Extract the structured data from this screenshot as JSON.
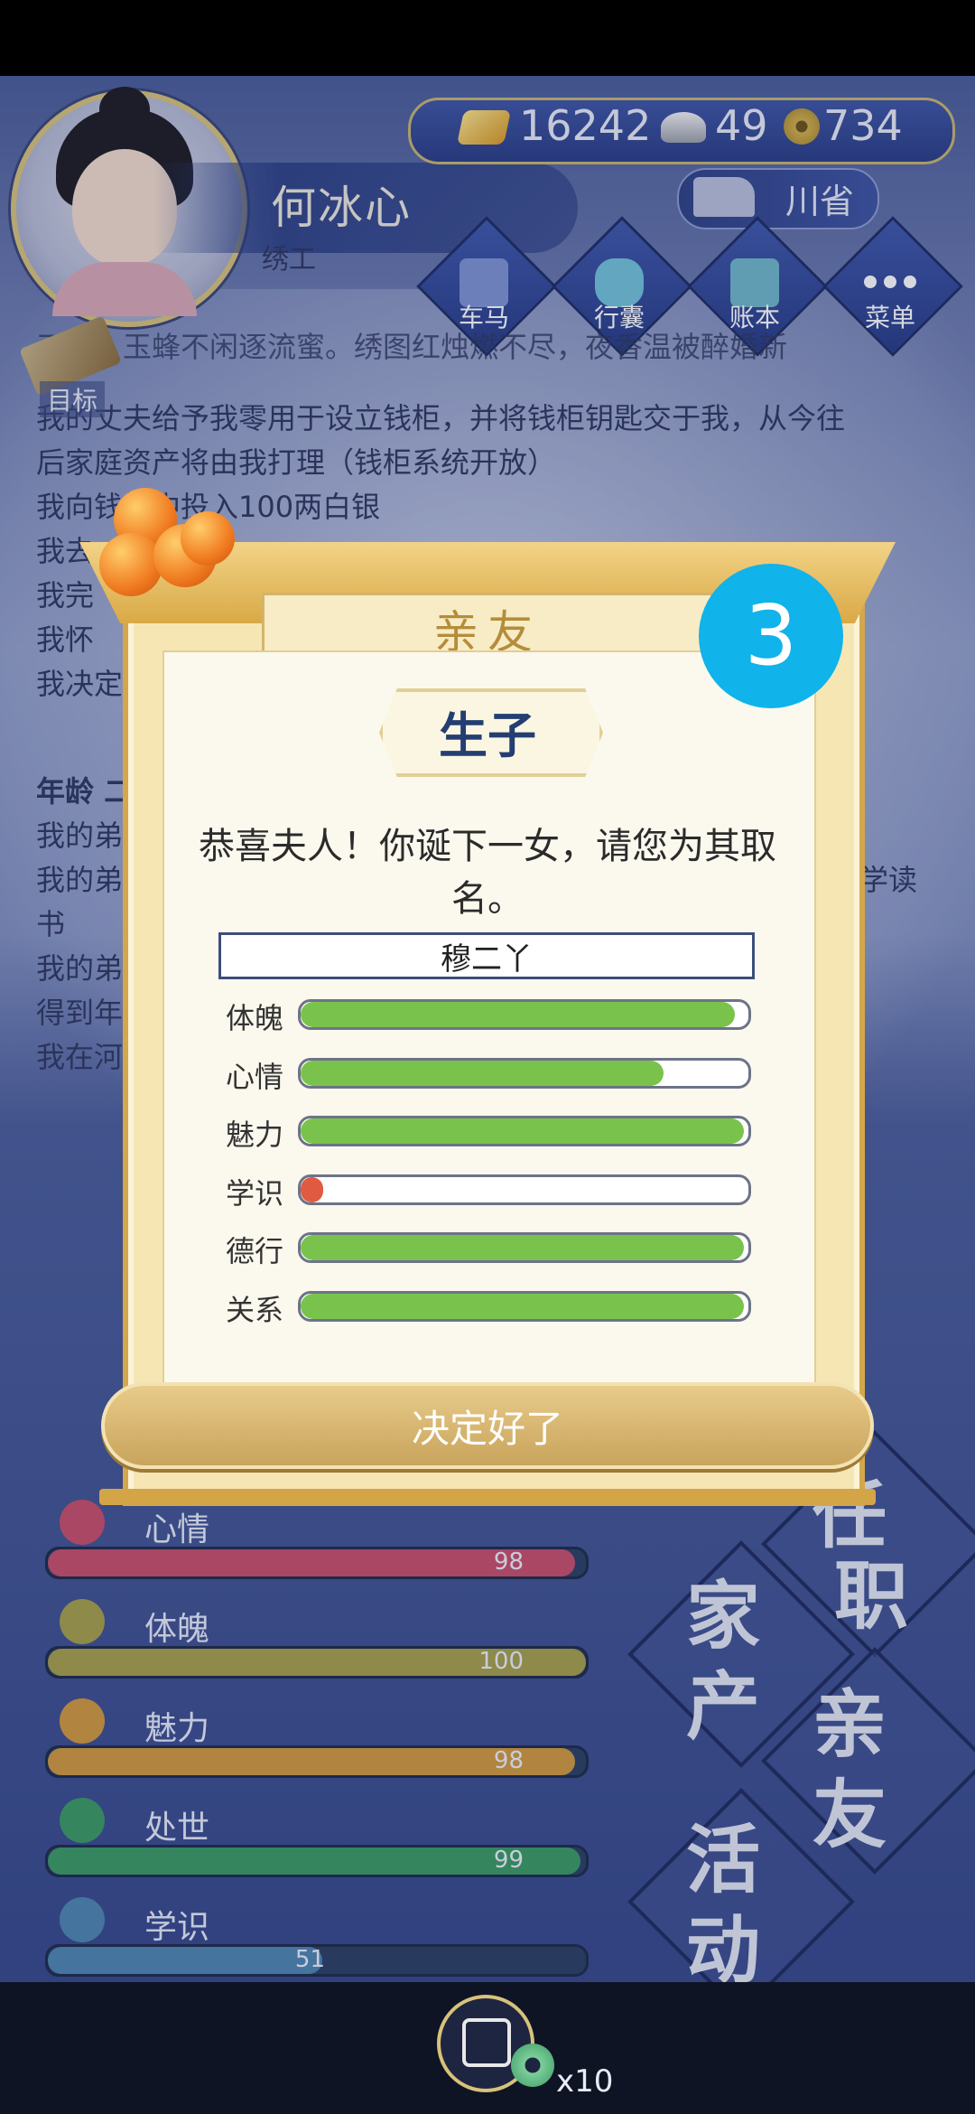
{
  "player": {
    "name": "何冰心",
    "title": "绣工",
    "region": "川省"
  },
  "currency": {
    "gold": "16242",
    "silver": "49",
    "coin": "734"
  },
  "nav": [
    {
      "label": "车马",
      "icon": "carriage-icon"
    },
    {
      "label": "行囊",
      "icon": "bag-icon"
    },
    {
      "label": "账本",
      "icon": "ledger-icon"
    },
    {
      "label": "菜单",
      "icon": "menu-icon"
    }
  ],
  "goal_label": "目标",
  "story": {
    "partial_top": "天喜，玉蜂不闲逐流蜜。绣图红烛燃不尽，夜香温被醉婚新",
    "lines": [
      "我的丈夫给予我零用于设立钱柜，并将钱柜钥匙交于我，从今往",
      "后家庭资产将由我打理（钱柜系统开放）",
      "我向钱柜中投入100两白银",
      "我去",
      "我完",
      "我怀",
      "我决定"
    ],
    "age_heading": "年龄 二",
    "lines2": [
      "我的弟",
      "我的弟",
      "书",
      "我的弟",
      "得到年",
      "我在河"
    ],
    "line2_tail": "学读"
  },
  "stats": [
    {
      "label": "心情",
      "value": 98,
      "max": 100,
      "color": "#c94f69",
      "icon": "flower-icon"
    },
    {
      "label": "体魄",
      "value": 100,
      "max": 100,
      "color": "#a7a04a",
      "icon": "dumbbell-icon"
    },
    {
      "label": "魅力",
      "value": 98,
      "max": 100,
      "color": "#d29a3d",
      "icon": "mirror-icon"
    },
    {
      "label": "处世",
      "value": 99,
      "max": 100,
      "color": "#3b9a63",
      "icon": "scroll-icon"
    },
    {
      "label": "学识",
      "value": 51,
      "max": 100,
      "color": "#4f86b0",
      "icon": "brush-pot-icon"
    },
    {
      "label": "德行",
      "value": "",
      "max": 100,
      "color": "#9a3f6c",
      "icon": "medal-icon"
    }
  ],
  "side_buttons": [
    "任职",
    "家产",
    "亲友",
    "活动"
  ],
  "side_button_top_partial": "任",
  "reward": {
    "count": "x10"
  },
  "modal": {
    "header": "亲友",
    "step": "3",
    "subtitle": "生子",
    "message": "恭喜夫人！你诞下一女，请您为其取名。",
    "name_value": "穆二丫",
    "attributes": [
      {
        "label": "体魄",
        "fraction": 0.97,
        "color": "#79c34c"
      },
      {
        "label": "心情",
        "fraction": 0.81,
        "color": "#79c34c"
      },
      {
        "label": "魅力",
        "fraction": 0.99,
        "color": "#79c34c"
      },
      {
        "label": "学识",
        "fraction": 0.05,
        "color": "#e05a42"
      },
      {
        "label": "德行",
        "fraction": 0.99,
        "color": "#79c34c"
      },
      {
        "label": "关系",
        "fraction": 0.99,
        "color": "#79c34c"
      }
    ],
    "confirm_label": "决定好了"
  }
}
